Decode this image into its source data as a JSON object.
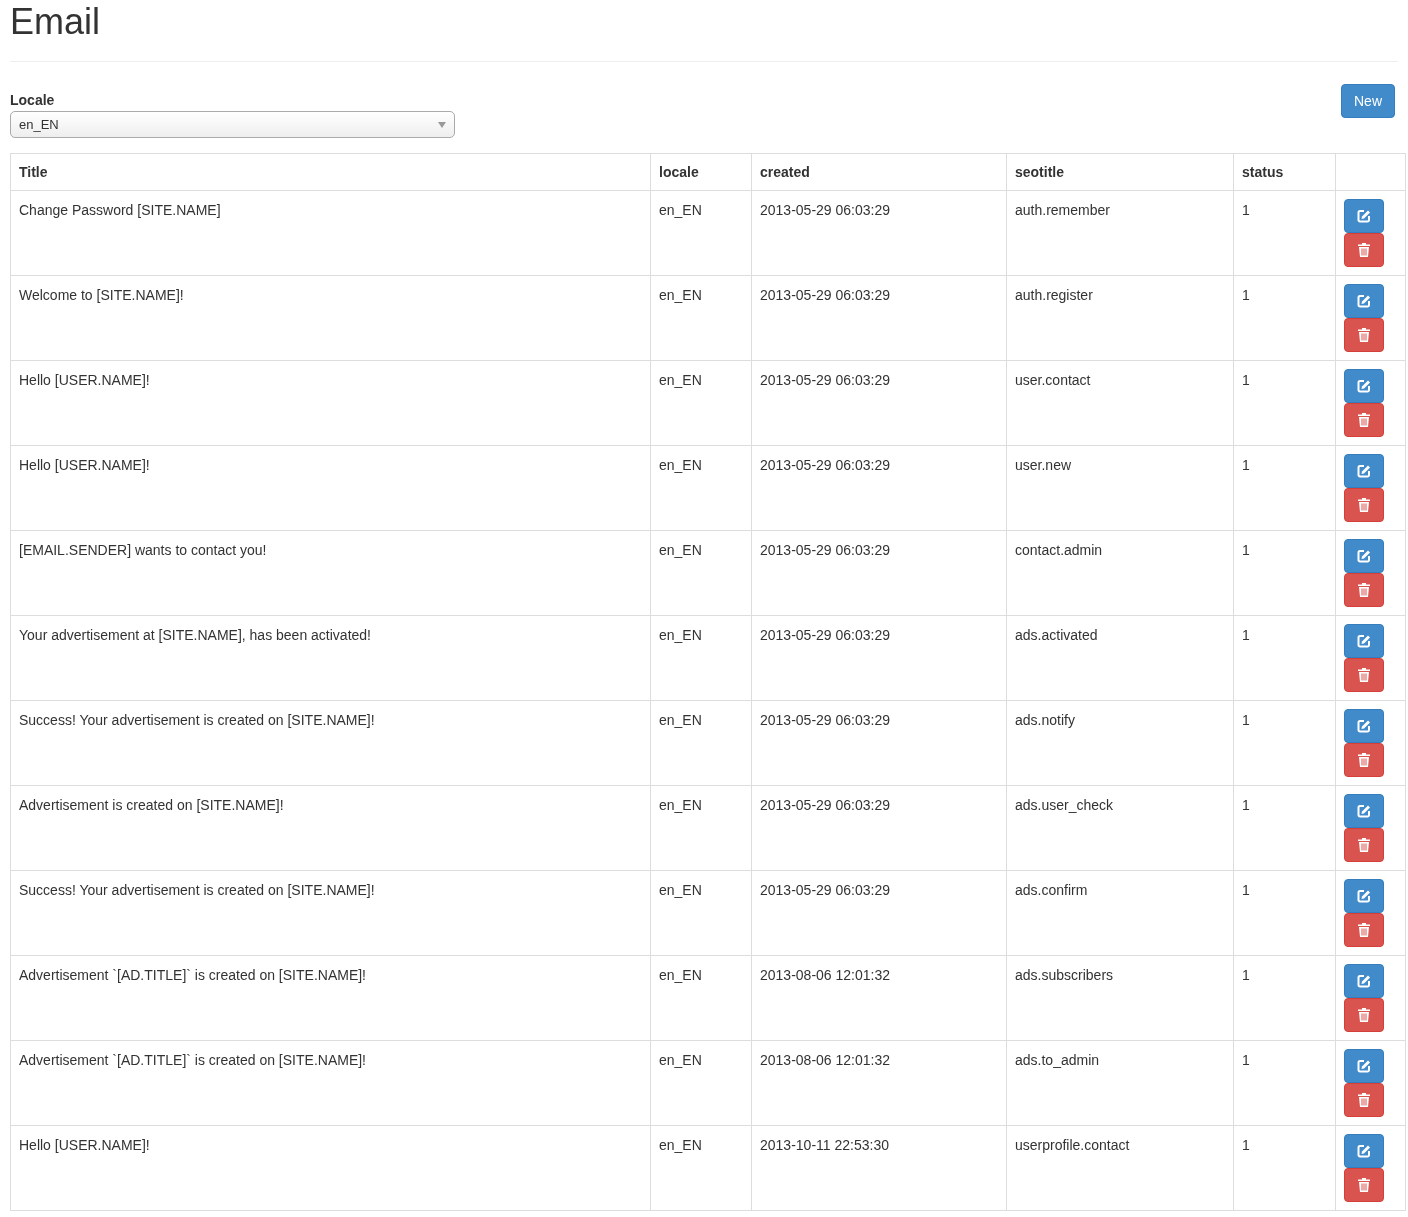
{
  "page_title": "Email",
  "new_button": "New",
  "locale_filter": {
    "label": "Locale",
    "value": "en_EN"
  },
  "table": {
    "columns": [
      "Title",
      "locale",
      "created",
      "seotitle",
      "status"
    ],
    "rows": [
      {
        "title": "Change Password [SITE.NAME]",
        "locale": "en_EN",
        "created": "2013-05-29 06:03:29",
        "seotitle": "auth.remember",
        "status": "1"
      },
      {
        "title": "Welcome to [SITE.NAME]!",
        "locale": "en_EN",
        "created": "2013-05-29 06:03:29",
        "seotitle": "auth.register",
        "status": "1"
      },
      {
        "title": "Hello [USER.NAME]!",
        "locale": "en_EN",
        "created": "2013-05-29 06:03:29",
        "seotitle": "user.contact",
        "status": "1"
      },
      {
        "title": "Hello [USER.NAME]!",
        "locale": "en_EN",
        "created": "2013-05-29 06:03:29",
        "seotitle": "user.new",
        "status": "1"
      },
      {
        "title": "[EMAIL.SENDER] wants to contact you!",
        "locale": "en_EN",
        "created": "2013-05-29 06:03:29",
        "seotitle": "contact.admin",
        "status": "1"
      },
      {
        "title": "Your advertisement at [SITE.NAME], has been activated!",
        "locale": "en_EN",
        "created": "2013-05-29 06:03:29",
        "seotitle": "ads.activated",
        "status": "1"
      },
      {
        "title": "Success! Your advertisement is created on [SITE.NAME]!",
        "locale": "en_EN",
        "created": "2013-05-29 06:03:29",
        "seotitle": "ads.notify",
        "status": "1"
      },
      {
        "title": "Advertisement is created on [SITE.NAME]!",
        "locale": "en_EN",
        "created": "2013-05-29 06:03:29",
        "seotitle": "ads.user_check",
        "status": "1"
      },
      {
        "title": "Success! Your advertisement is created on [SITE.NAME]!",
        "locale": "en_EN",
        "created": "2013-05-29 06:03:29",
        "seotitle": "ads.confirm",
        "status": "1"
      },
      {
        "title": "Advertisement `[AD.TITLE]` is created on [SITE.NAME]!",
        "locale": "en_EN",
        "created": "2013-08-06 12:01:32",
        "seotitle": "ads.subscribers",
        "status": "1"
      },
      {
        "title": "Advertisement `[AD.TITLE]` is created on [SITE.NAME]!",
        "locale": "en_EN",
        "created": "2013-08-06 12:01:32",
        "seotitle": "ads.to_admin",
        "status": "1"
      },
      {
        "title": "Hello [USER.NAME]!",
        "locale": "en_EN",
        "created": "2013-10-11 22:53:30",
        "seotitle": "userprofile.contact",
        "status": "1"
      }
    ]
  }
}
